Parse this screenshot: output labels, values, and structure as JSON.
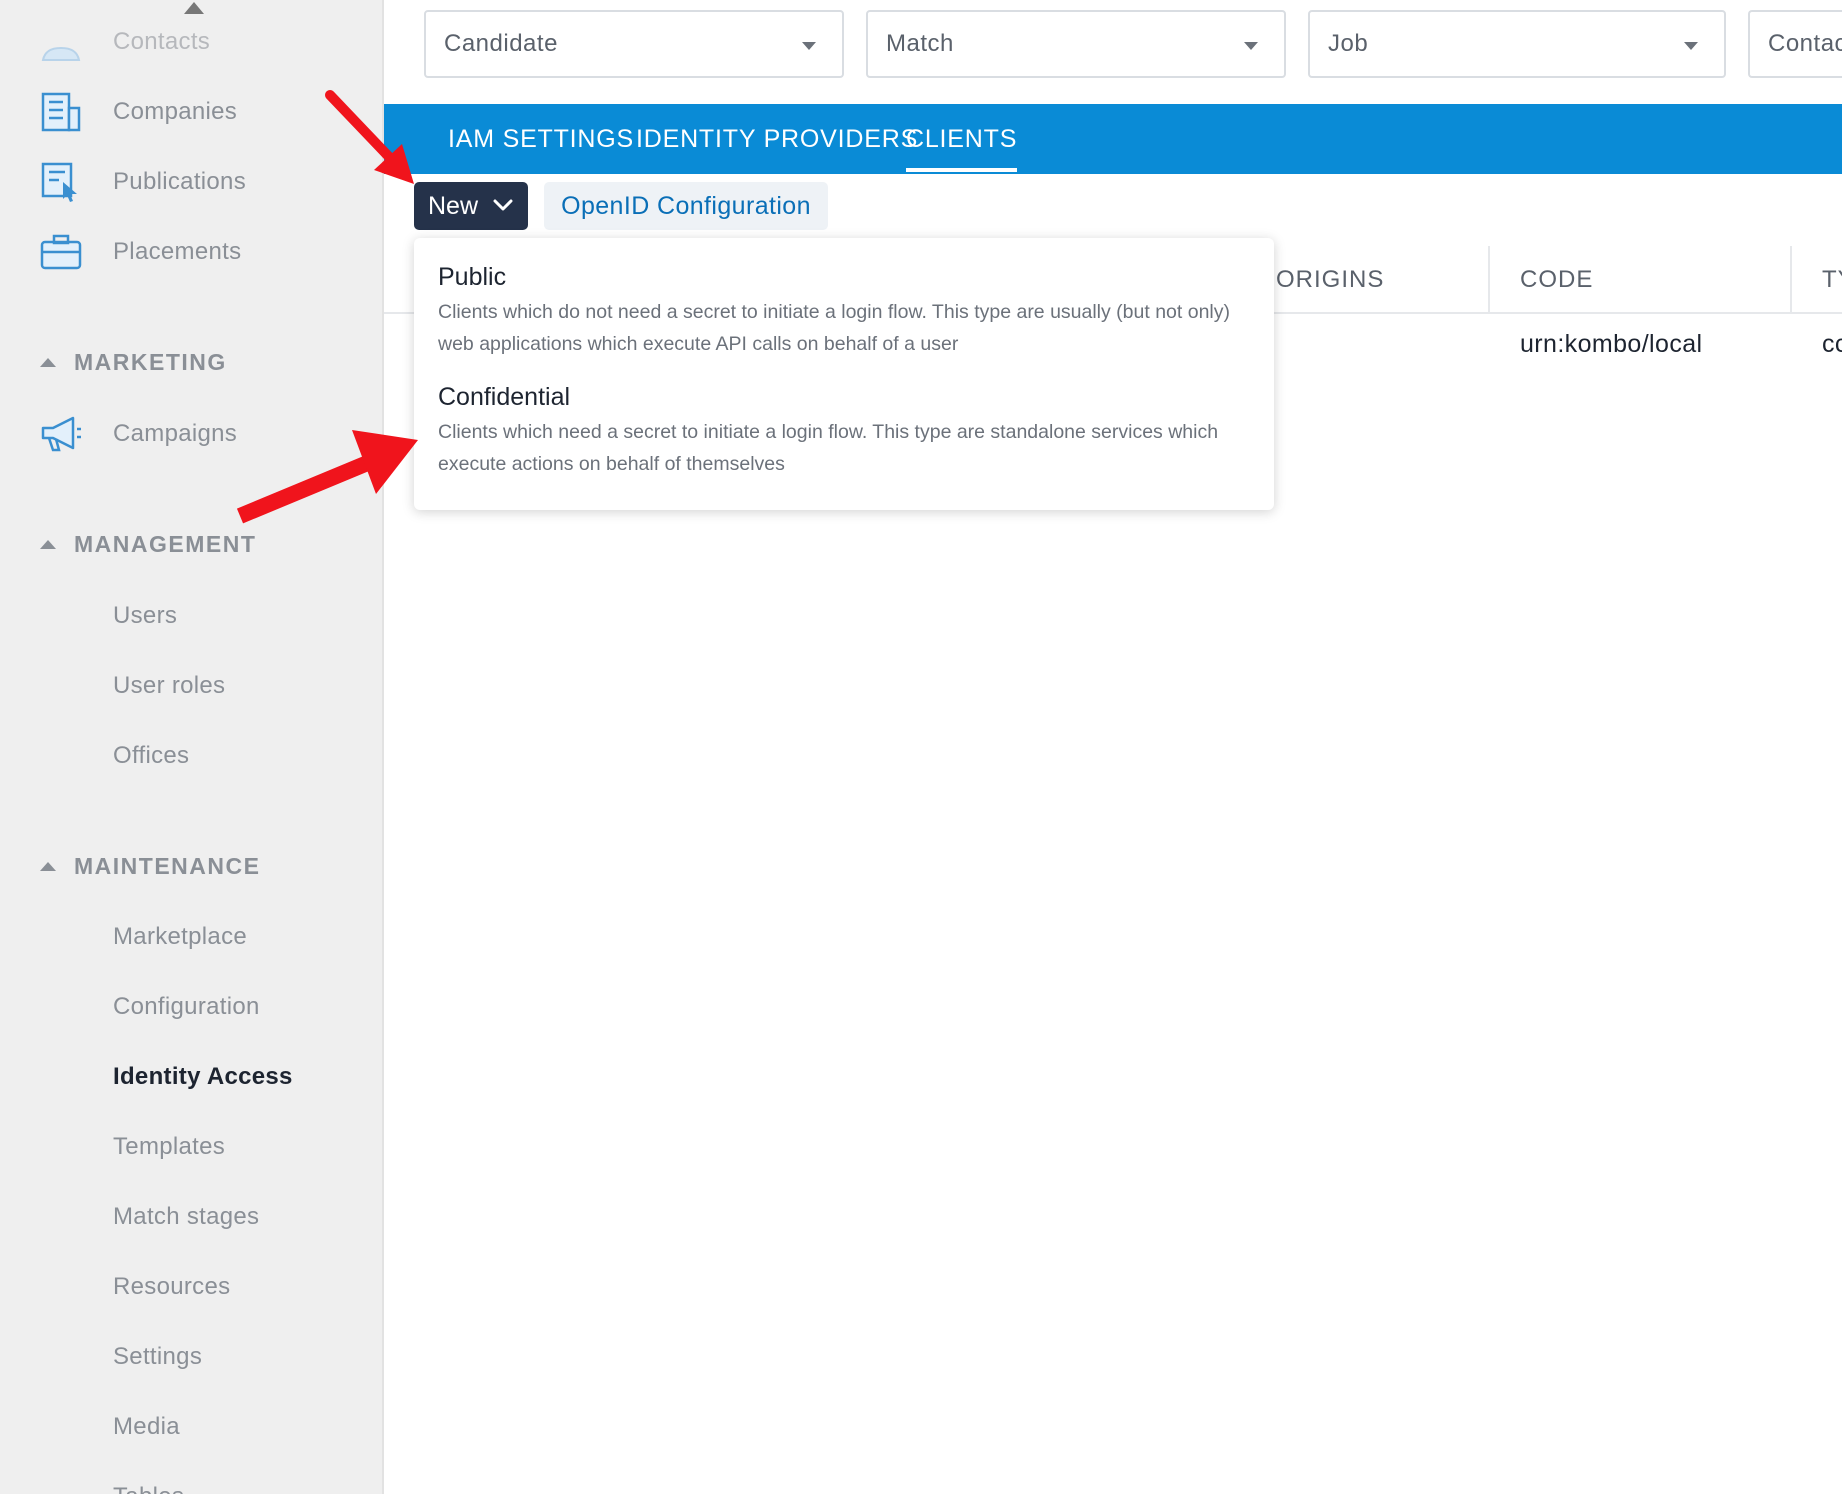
{
  "sidebar": {
    "items_top": [
      {
        "label": "Contacts",
        "icon": "contacts-icon"
      },
      {
        "label": "Companies",
        "icon": "building-icon"
      },
      {
        "label": "Publications",
        "icon": "publication-icon"
      },
      {
        "label": "Placements",
        "icon": "briefcase-icon"
      }
    ],
    "sections": [
      {
        "label": "MARKETING"
      },
      {
        "label": "MANAGEMENT"
      },
      {
        "label": "MAINTENANCE"
      }
    ],
    "marketing_items": [
      {
        "label": "Campaigns",
        "icon": "megaphone-icon"
      }
    ],
    "management_items": [
      {
        "label": "Users"
      },
      {
        "label": "User roles"
      },
      {
        "label": "Offices"
      }
    ],
    "maintenance_items": [
      {
        "label": "Marketplace"
      },
      {
        "label": "Configuration"
      },
      {
        "label": "Identity Access"
      },
      {
        "label": "Templates"
      },
      {
        "label": "Match stages"
      },
      {
        "label": "Resources"
      },
      {
        "label": "Settings"
      },
      {
        "label": "Media"
      },
      {
        "label": "Tables"
      }
    ],
    "active_item": "Identity Access"
  },
  "selects": [
    {
      "label": "Candidate"
    },
    {
      "label": "Match"
    },
    {
      "label": "Job"
    },
    {
      "label": "Contac"
    }
  ],
  "tabs": [
    {
      "label": "IAM SETTINGS"
    },
    {
      "label": "IDENTITY PROVIDERS"
    },
    {
      "label": "CLIENTS"
    }
  ],
  "active_tab": "CLIENTS",
  "toolbar": {
    "new_label": "New",
    "openid_label": "OpenID Configuration"
  },
  "table": {
    "headers": [
      "ORIGINS",
      "CODE",
      "TY"
    ],
    "rows": [
      {
        "code": "urn:kombo/local",
        "type": "cc"
      }
    ]
  },
  "new_menu": {
    "items": [
      {
        "title": "Public",
        "description": "Clients which do not need a secret to initiate a login flow. This type are usually (but not only) web applications which execute API calls on behalf of a user"
      },
      {
        "title": "Confidential",
        "description": "Clients which need a secret to initiate a login flow. This type are standalone services which execute actions on behalf of themselves"
      }
    ]
  },
  "colors": {
    "primary": "#0a8bd6",
    "new_button": "#25324a",
    "annotation_arrow": "#f0141c",
    "sidebar_bg": "#efefef"
  }
}
